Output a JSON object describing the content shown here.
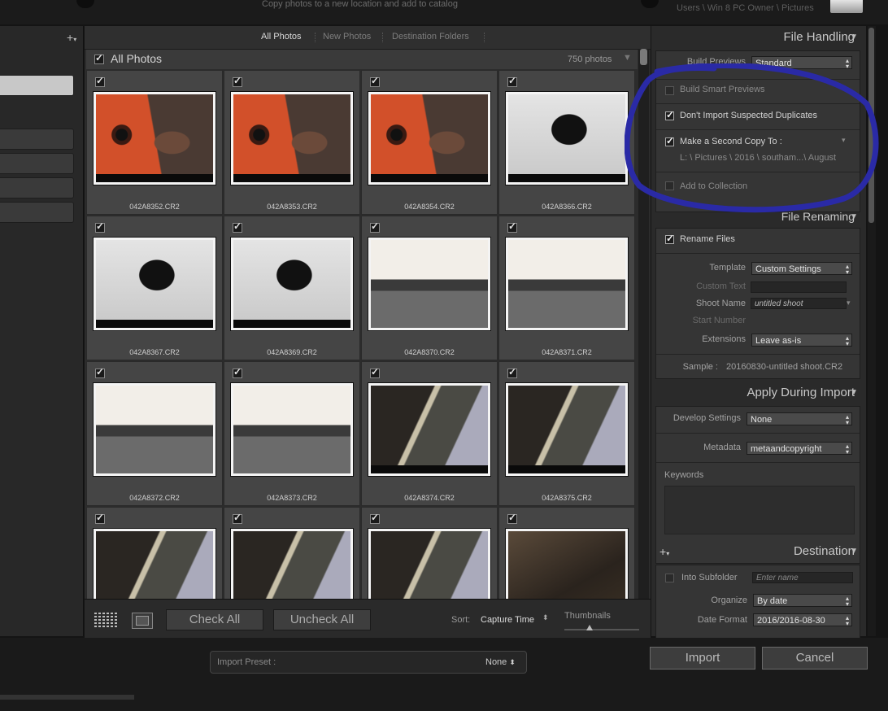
{
  "header": {
    "subtitle": "Copy photos to a new location and add to catalog",
    "destination_path": "Users \\ Win 8 PC Owner \\ Pictures"
  },
  "source_tabs": {
    "items": [
      "All Photos",
      "New Photos",
      "Destination Folders"
    ],
    "active": "All Photos"
  },
  "grid_header": {
    "title": "All Photos",
    "count": "750 photos"
  },
  "photos": [
    {
      "file": "042A8352.CR2",
      "kind": "orange"
    },
    {
      "file": "042A8353.CR2",
      "kind": "orange"
    },
    {
      "file": "042A8354.CR2",
      "kind": "orange"
    },
    {
      "file": "042A8366.CR2",
      "kind": "white"
    },
    {
      "file": "042A8367.CR2",
      "kind": "white"
    },
    {
      "file": "042A8369.CR2",
      "kind": "white"
    },
    {
      "file": "042A8370.CR2",
      "kind": "pier"
    },
    {
      "file": "042A8371.CR2",
      "kind": "pier"
    },
    {
      "file": "042A8372.CR2",
      "kind": "pier"
    },
    {
      "file": "042A8373.CR2",
      "kind": "pier"
    },
    {
      "file": "042A8374.CR2",
      "kind": "hull"
    },
    {
      "file": "042A8375.CR2",
      "kind": "hull"
    },
    {
      "file": "",
      "kind": "hull"
    },
    {
      "file": "",
      "kind": "hull"
    },
    {
      "file": "",
      "kind": "hull"
    },
    {
      "file": "",
      "kind": "dark"
    }
  ],
  "toolbar": {
    "check_all": "Check All",
    "uncheck_all": "Uncheck All",
    "sort_label": "Sort:",
    "sort_value": "Capture Time",
    "thumbnails_label": "Thumbnails"
  },
  "file_handling": {
    "title": "File Handling",
    "build_previews_label": "Build Previews",
    "build_previews_value": "Standard",
    "smart_previews": "Build Smart Previews",
    "no_duplicates": "Don't Import Suspected Duplicates",
    "second_copy": "Make a Second Copy To :",
    "second_copy_path": "L: \\ Pictures \\ 2016 \\ southam...\\ August",
    "add_collection": "Add to Collection"
  },
  "file_renaming": {
    "title": "File Renaming",
    "rename_files": "Rename Files",
    "template_label": "Template",
    "template_value": "Custom Settings",
    "custom_text_label": "Custom Text",
    "shoot_name_label": "Shoot Name",
    "shoot_name_value": "untitled shoot",
    "start_number_label": "Start Number",
    "extensions_label": "Extensions",
    "extensions_value": "Leave as-is",
    "sample_label": "Sample :",
    "sample_value": "20160830-untitled shoot.CR2"
  },
  "apply_during_import": {
    "title": "Apply During Import",
    "develop_label": "Develop Settings",
    "develop_value": "None",
    "metadata_label": "Metadata",
    "metadata_value": "metaandcopyright",
    "keywords_label": "Keywords"
  },
  "destination": {
    "title": "Destination",
    "into_subfolder": "Into Subfolder",
    "subfolder_placeholder": "Enter name",
    "organize_label": "Organize",
    "organize_value": "By date",
    "date_format_label": "Date Format",
    "date_format_value": "2016/2016-08-30"
  },
  "footer": {
    "import_preset_label": "Import Preset :",
    "import_preset_value": "None",
    "import_button": "Import",
    "cancel_button": "Cancel"
  },
  "colors": {
    "annotation": "#2a2aa6"
  }
}
